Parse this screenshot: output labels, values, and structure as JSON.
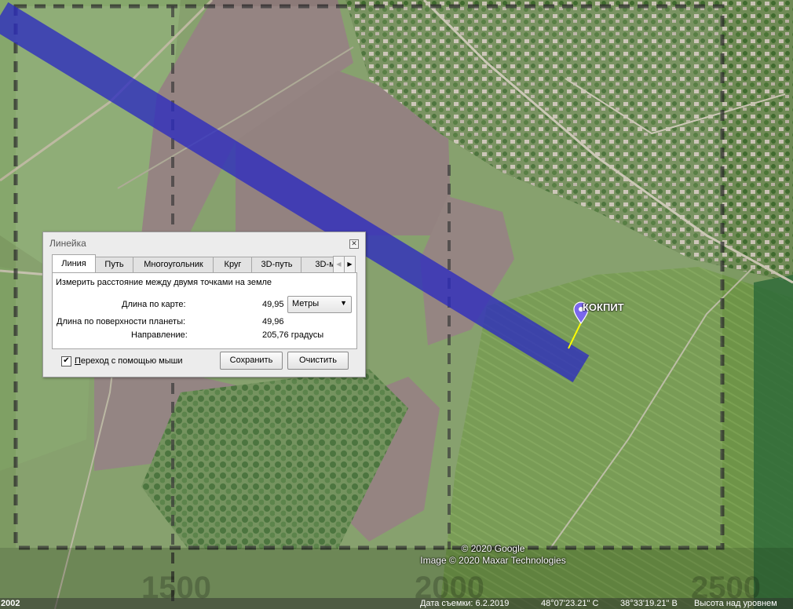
{
  "map": {
    "copyright_line1": "© 2020 Google",
    "copyright_line2": "Image © 2020 Maxar Technologies",
    "placemark_label": "КОКПИТ",
    "scale_labels": [
      "2000",
      "2500",
      "1500"
    ]
  },
  "status_bar": {
    "left_number": "2002",
    "capture_date": "Дата съемки: 6.2.2019",
    "latitude": "48°07'23.21\" С",
    "longitude": "38°33'19.21\" В",
    "elevation_label": "Высота над уровнем"
  },
  "ruler": {
    "title": "Линейка",
    "tabs": [
      "Линия",
      "Путь",
      "Многоугольник",
      "Круг",
      "3D-путь",
      "3D-м"
    ],
    "active_tab": "Линия",
    "description": "Измерить расстояние между двумя точками на земле",
    "map_length_label": "Длина по карте:",
    "map_length_value": "49,95",
    "units": "Метры",
    "surface_length_label": "Длина по поверхности планеты:",
    "surface_length_value": "49,96",
    "heading_label": "Направление:",
    "heading_value": "205,76 градусы",
    "mouse_nav_label": "Переход с помощью мыши",
    "mouse_nav_checked": true,
    "save_button": "Сохранить",
    "clear_button": "Очистить"
  },
  "colors": {
    "flight_path": "#2c2ac0",
    "measure_line": "#ffff00",
    "placemark": "#7b68ee"
  }
}
